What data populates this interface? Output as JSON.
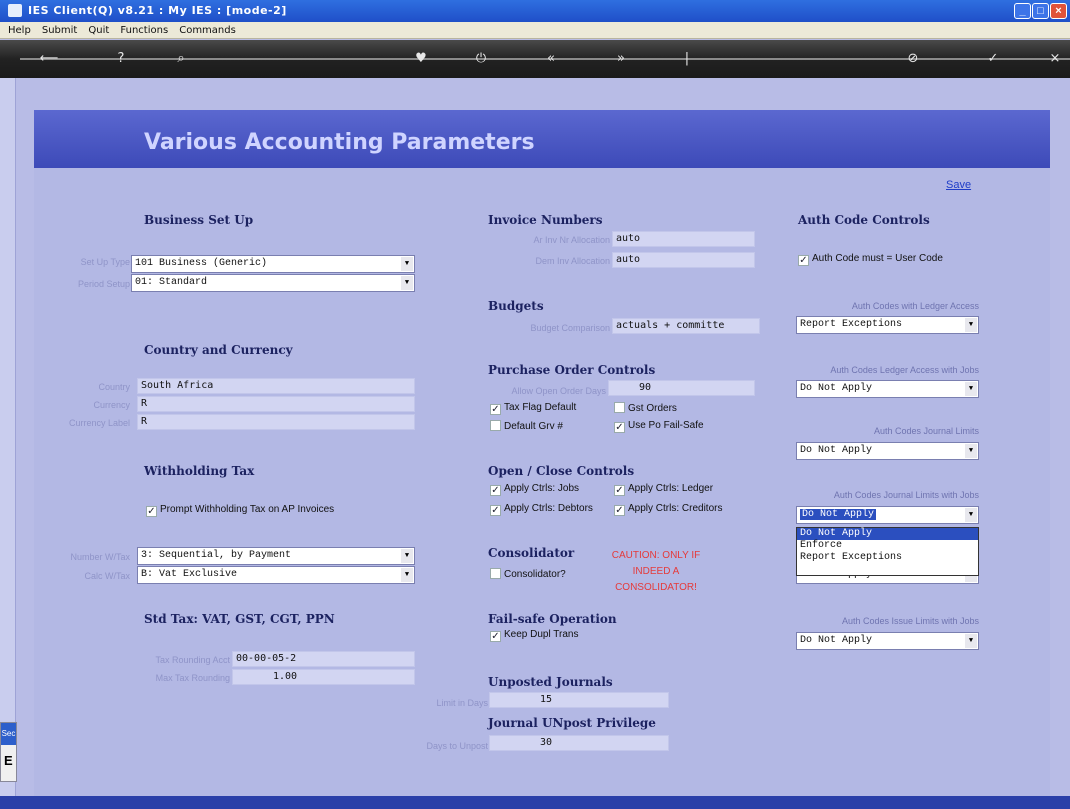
{
  "window": {
    "title": "IES Client(Q) v8.21 : My IES :      [mode-2]"
  },
  "menu": [
    "Help",
    "Submit",
    "Quit",
    "Functions",
    "Commands"
  ],
  "toolbar": {
    "back_icon": "arrow-left-icon",
    "info_icon": "info-icon",
    "search_icon": "search-icon",
    "favorite_icon": "heart-icon",
    "power_icon": "power-icon",
    "prev_icon": "double-chevron-left-icon",
    "next_icon": "double-chevron-right-icon",
    "cancel_icon": "cancel-icon",
    "ok_icon": "check-icon",
    "close_icon": "close-icon"
  },
  "page": {
    "title": "Various Accounting Parameters",
    "save_label": "Save"
  },
  "business": {
    "heading": "Business Set Up",
    "setup_type_label": "Set Up Type",
    "setup_type_value": "101 Business (Generic)",
    "period_setup_label": "Period Setup",
    "period_setup_value": "01: Standard"
  },
  "country": {
    "heading": "Country and Currency",
    "country_label": "Country",
    "country_value": "South Africa",
    "currency_label": "Currency",
    "currency_value": "R",
    "currency_label_label": "Currency Label",
    "currency_label_value": "R"
  },
  "withholding": {
    "heading": "Withholding Tax",
    "prompt_label": "Prompt Withholding Tax on AP Invoices",
    "prompt_checked": true
  },
  "numbering": {
    "number_label": "Number W/Tax",
    "number_value": "3: Sequential, by Payment",
    "calc_label": "Calc W/Tax",
    "calc_value": "B: Vat Exclusive"
  },
  "stdtax": {
    "heading": "Std Tax: VAT, GST, CGT, PPN",
    "rounding_acct_label": "Tax Rounding Acct",
    "rounding_acct_value": "00-00-05-2",
    "max_rounding_label": "Max Tax Rounding",
    "max_rounding_value": "1.00"
  },
  "invoice": {
    "heading": "Invoice Numbers",
    "ar_label": "Ar Inv Nr Allocation",
    "ar_value": "auto",
    "dem_label": "Dem Inv Allocation",
    "dem_value": "auto"
  },
  "budgets": {
    "heading": "Budgets",
    "comparison_label": "Budget Comparison",
    "comparison_value": "actuals + committe"
  },
  "po": {
    "heading": "Purchase Order Controls",
    "open_days_label": "Allow Open Order Days",
    "open_days_value": "90",
    "tax_flag_label": "Tax Flag Default",
    "tax_flag_checked": true,
    "gst_orders_label": "Gst Orders",
    "gst_orders_checked": false,
    "default_grv_label": "Default Grv #",
    "default_grv_checked": false,
    "failsafe_label": "Use Po Fail-Safe",
    "failsafe_checked": true
  },
  "openclose": {
    "heading": "Open / Close Controls",
    "jobs_label": "Apply Ctrls: Jobs",
    "ledger_label": "Apply Ctrls: Ledger",
    "debtors_label": "Apply Ctrls: Debtors",
    "creditors_label": "Apply Ctrls: Creditors"
  },
  "consolidator": {
    "heading": "Consolidator",
    "caution": "CAUTION: ONLY IF INDEED A CONSOLIDATOR!",
    "checkbox_label": "Consolidator?",
    "checked": false
  },
  "failsafe_op": {
    "heading": "Fail-safe Operation",
    "keep_dupl_label": "Keep Dupl Trans",
    "checked": true
  },
  "unposted": {
    "heading": "Unposted Journals",
    "limit_label": "Limit in Days",
    "limit_value": "15"
  },
  "unpost_priv": {
    "heading": "Journal UNpost Privilege",
    "days_label": "Days to Unpost",
    "days_value": "30"
  },
  "auth": {
    "heading": "Auth Code Controls",
    "must_user_label": "Auth Code must = User Code",
    "must_user_checked": true,
    "ledger_access_label": "Auth Codes with Ledger Access",
    "ledger_access_value": "Report Exceptions",
    "ledger_jobs_label": "Auth Codes Ledger Access with Jobs",
    "ledger_jobs_value": "Do Not Apply",
    "journal_limits_label": "Auth Codes Journal Limits",
    "journal_limits_value": "Do Not Apply",
    "journal_limits_jobs_label": "Auth Codes Journal Limits with Jobs",
    "journal_limits_jobs_value": "Do Not Apply",
    "hidden_select_value": "Do Not Apply",
    "issue_limits_jobs_label": "Auth Codes Issue Limits with Jobs",
    "issue_limits_jobs_value": "Do Not Apply",
    "dropdown_options": [
      "Do Not Apply",
      "Enforce",
      "Report Exceptions"
    ]
  },
  "sidebar": {
    "tab_label": "Sec",
    "glyph": "E"
  }
}
